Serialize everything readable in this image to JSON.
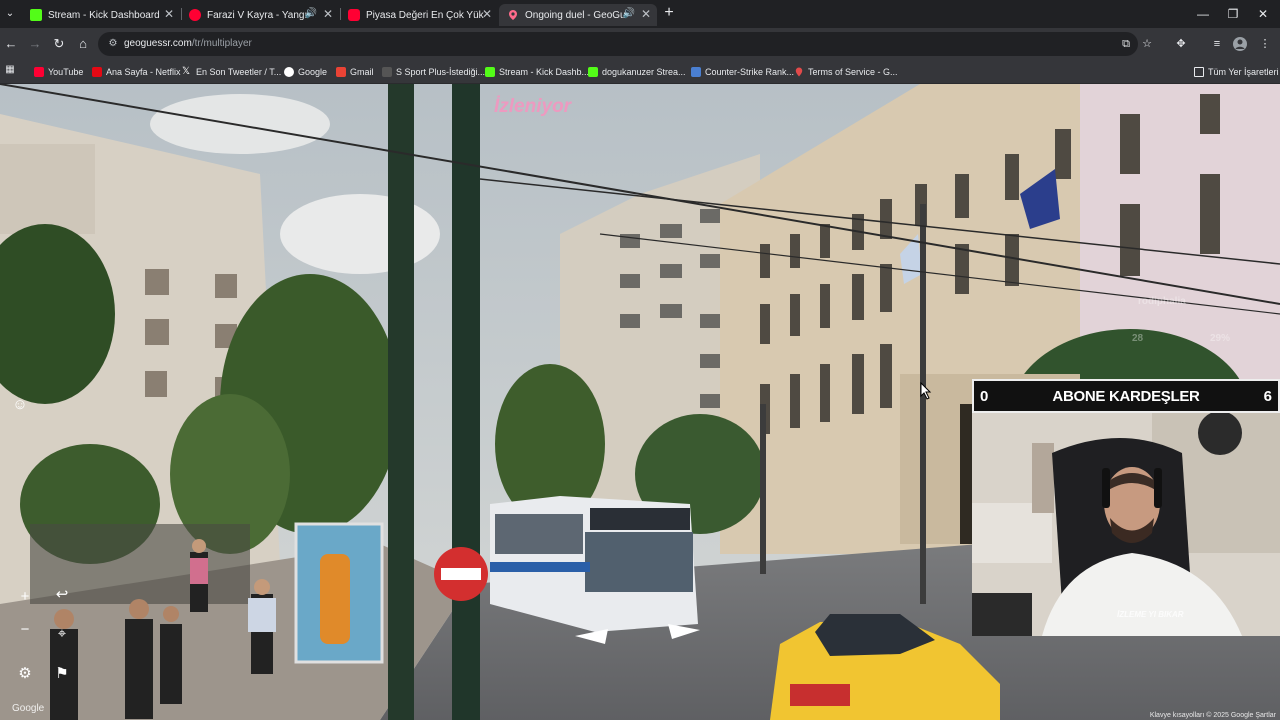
{
  "browser": {
    "tabs": [
      {
        "title": "Stream - Kick Dashboard",
        "favicon_color": "#53fc18",
        "favicon_icon": "kick-icon",
        "active": false
      },
      {
        "title": "Farazi V Kayra - Yangın III: 1",
        "favicon_color": "#ff0033",
        "favicon_icon": "youtube-icon",
        "active": false,
        "audio": true
      },
      {
        "title": "Piyasa Değeri En Çok Yükselen",
        "favicon_color": "#ff0033",
        "favicon_icon": "youtube-icon",
        "active": false
      },
      {
        "title": "Ongoing duel - GeoGuessr",
        "favicon_color": "#e8eaed",
        "favicon_icon": "map-pin-icon",
        "active": true,
        "audio": true
      }
    ],
    "url": {
      "host": "geoguessr.com",
      "path": "/tr/multiplayer"
    },
    "bookmarks": [
      {
        "label": "YouTube",
        "favicon_color": "#ff0033"
      },
      {
        "label": "Ana Sayfa - Netflix",
        "favicon_color": "#e50914"
      },
      {
        "label": "En Son Tweetler / T...",
        "favicon_color": "#ffffff"
      },
      {
        "label": "Google",
        "favicon_color": "#4285f4"
      },
      {
        "label": "Gmail",
        "favicon_color": "#ea4335"
      },
      {
        "label": "S Sport Plus-İstediği...",
        "favicon_color": "#222222"
      },
      {
        "label": "Stream - Kick Dashb...",
        "favicon_color": "#53fc18"
      },
      {
        "label": "dogukanuzer Strea...",
        "favicon_color": "#53fc18"
      },
      {
        "label": "Counter-Strike Rank...",
        "favicon_color": "#4a7fd1"
      },
      {
        "label": "Terms of Service - G...",
        "favicon_color": "#e24a4a"
      }
    ],
    "all_bookmarks_label": "Tüm Yer İşaretleri"
  },
  "game": {
    "watching_label": "İzleniyor",
    "google_logo": "Google",
    "copyright": "Klavye kısayolları  © 2025 Google  Şartlar"
  },
  "stream_overlay": {
    "left_score": "0",
    "banner_text": "ABONE KARDEŞLER",
    "right_score": "6",
    "brand": "İZLEME YI BIKAR"
  }
}
